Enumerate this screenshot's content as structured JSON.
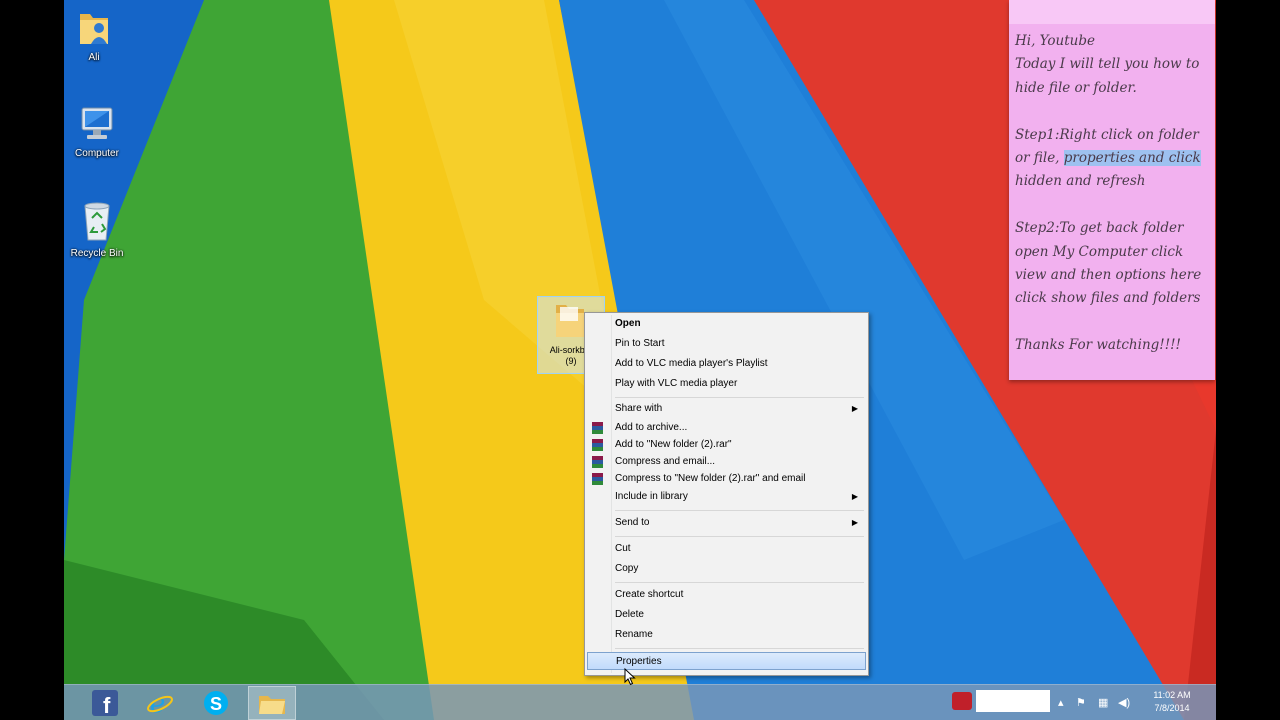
{
  "desktop": {
    "icons": [
      {
        "label": "Ali",
        "icon": "user-folder-icon"
      },
      {
        "label": "Computer",
        "icon": "computer-icon"
      },
      {
        "label": "Recycle Bin",
        "icon": "recycle-bin-icon"
      }
    ],
    "selected_folder": {
      "label": "Ali-sorkb...\n(9)",
      "icon": "folder-icon"
    }
  },
  "context_menu": {
    "items": [
      {
        "label": "Open",
        "bold": true
      },
      {
        "label": "Pin to Start"
      },
      {
        "label": "Add to VLC media player's Playlist"
      },
      {
        "label": "Play with VLC media player"
      },
      {
        "label": "Share with",
        "submenu": true
      },
      {
        "label": "Add to archive...",
        "icon": "winrar-icon"
      },
      {
        "label": "Add to \"New folder (2).rar\"",
        "icon": "winrar-icon"
      },
      {
        "label": "Compress and email...",
        "icon": "winrar-icon"
      },
      {
        "label": "Compress to \"New folder (2).rar\" and email",
        "icon": "winrar-icon"
      },
      {
        "label": "Include in library",
        "submenu": true
      },
      {
        "label": "Send to",
        "submenu": true
      },
      {
        "label": "Cut"
      },
      {
        "label": "Copy"
      },
      {
        "label": "Create shortcut"
      },
      {
        "label": "Delete"
      },
      {
        "label": "Rename"
      },
      {
        "label": "Properties",
        "highlighted": true
      }
    ]
  },
  "sticky_note": {
    "line1": "Hi, Youtube",
    "line2": "Today I will tell you how to hide file or folder.",
    "step1_a": "Step1:Right click on folder or file, ",
    "step1_highlight": "properties and click",
    "step1_b": " hidden and refresh",
    "step2": "Step2:To get back folder open My Computer click view and then options here click show files and folders",
    "thanks": "Thanks For watching!!!!"
  },
  "taskbar": {
    "pinned": [
      "facebook-icon",
      "internet-explorer-icon",
      "skype-icon",
      "file-explorer-icon"
    ],
    "clock_time": "11:02 AM",
    "clock_date": "7/8/2014"
  },
  "colors": {
    "wall_blue_left": "#1565c8",
    "wall_green": "#3fa535",
    "wall_yellow": "#f5c91a",
    "wall_blue": "#1f7fd8",
    "wall_red": "#e0392e",
    "note": "#f2b1ef"
  }
}
